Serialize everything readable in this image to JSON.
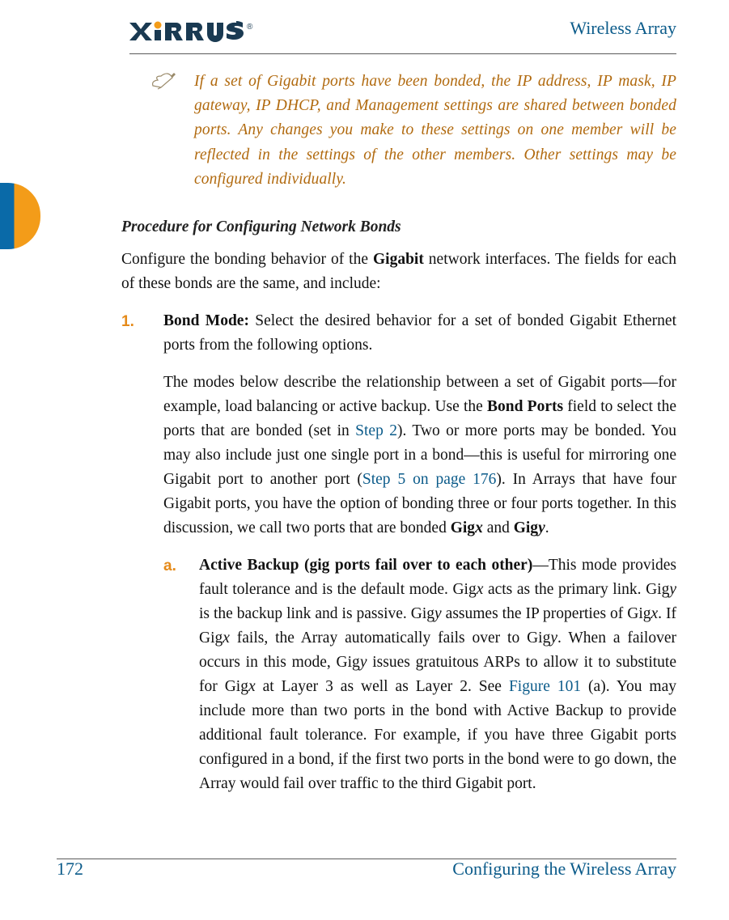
{
  "header": {
    "doc_title": "Wireless Array"
  },
  "note": {
    "text": "If a set of Gigabit ports have been bonded, the IP address, IP mask, IP gateway, IP DHCP, and Management settings are shared between bonded ports. Any changes you make to these settings on one member will be reflected in the settings of the other members. Other settings may be configured individually."
  },
  "content": {
    "procedure_heading": "Procedure for Configuring Network Bonds",
    "intro_pre": "Configure the bonding behavior of the ",
    "intro_bold": "Gigabit",
    "intro_post": " network interfaces. The fields for each of these bonds are the same, and include:",
    "item1": {
      "marker": "1.",
      "lead_bold": "Bond Mode:",
      "lead_rest": " Select the desired behavior for a set of bonded Gigabit Ethernet ports from the following options.",
      "p2_a": "The modes below describe the relationship between a set of Gigabit ports—for example, load balancing or active backup. Use the ",
      "p2_bold1": "Bond Ports",
      "p2_b": " field to select the ports that are bonded (set in ",
      "p2_link1": "Step 2",
      "p2_c": "). Two or more ports may be bonded. You may also include just one single port in a bond—this is useful for mirroring one Gigabit port to another port (",
      "p2_link2": "Step 5 on page 176",
      "p2_d": "). In Arrays that have four Gigabit ports, you have the option of bonding three or four ports together. In this discussion, we call two ports that are bonded ",
      "gig": "Gig",
      "x": "x",
      "and": " and ",
      "y": "y",
      "period": ".",
      "sub_a": {
        "marker": "a.",
        "lead_bold": "Active Backup (gig ports fail over to each other)",
        "t1": "—This mode provides fault tolerance and is the default mode. Gig",
        "t2": " acts as the primary link. Gig",
        "t3": " is the backup link and is passive. Gig",
        "t4": " assumes the IP properties of Gig",
        "t5": ". If Gig",
        "t6": " fails, the Array automatically fails over to Gig",
        "t7": ".   When a failover occurs in this mode, Gig",
        "t8": " issues gratuitous ARPs to allow it to substitute for Gig",
        "t9": " at Layer 3 as well as Layer 2. See ",
        "link": "Figure 101",
        "t10": " (a). You may include more than two ports in the bond with Active Backup to provide additional fault tolerance. For example, if you have three Gigabit ports configured in a bond, if the first two ports in the bond were to go down, the Array would fail over traffic to the third Gigabit port."
      }
    }
  },
  "footer": {
    "page_number": "172",
    "section_title": "Configuring the Wireless Array"
  }
}
